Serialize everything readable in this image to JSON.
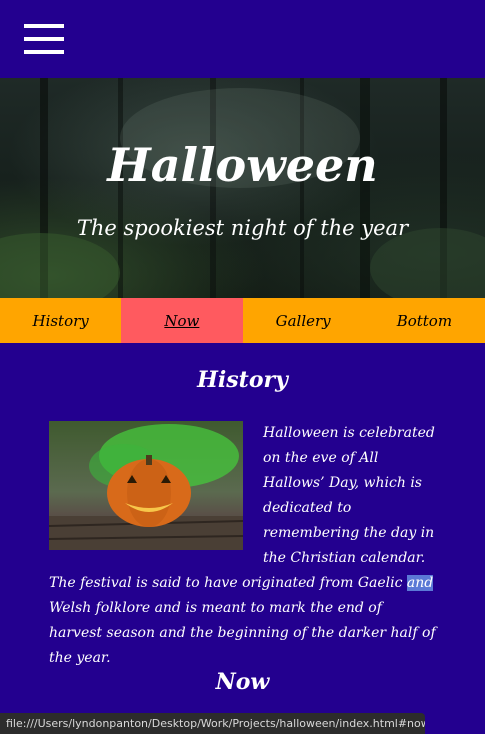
{
  "menu": {
    "icon": "hamburger-menu-icon"
  },
  "hero": {
    "title": "Halloween",
    "subtitle": "The spookiest night of the year"
  },
  "nav": {
    "items": [
      {
        "label": "History"
      },
      {
        "label": "Now"
      },
      {
        "label": "Gallery"
      },
      {
        "label": "Bottom"
      }
    ],
    "active": "Now",
    "bar_color": "#ffa500",
    "active_color": "#ff5a5f"
  },
  "sections": {
    "history": {
      "title": "History",
      "text_before_highlight": "Halloween is celebrated on the eve of All Hallows’ Day, which is dedicated to remembering the day in the Christian calendar. The festival is said to have originated from Gaelic ",
      "highlighted_word": "and",
      "text_after_highlight": " Welsh folklore and is meant to mark the end of harvest season and the beginning of the darker half of the year."
    },
    "now": {
      "title": "Now"
    }
  },
  "status_bar": {
    "url": "file:///Users/lyndonpanton/Desktop/Work/Projects/halloween/index.html#now"
  },
  "colors": {
    "page_background": "#23008f",
    "text": "#ffffff",
    "selection": "#5b79d6"
  }
}
